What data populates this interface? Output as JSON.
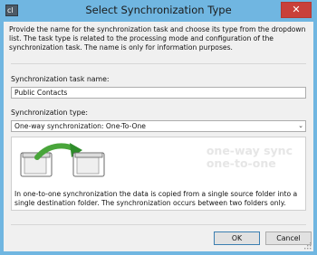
{
  "window": {
    "title": "Select Synchronization Type",
    "icon": "app-icon",
    "icon_text": "cl",
    "close_glyph": "✕",
    "accent": "#70b6e1"
  },
  "intro_text": "Provide the name for the synchronization task and choose its type from the dropdown list. The task type is related to the processing mode and configuration of the synchronization task. The name is only for information purposes.",
  "task_name": {
    "label": "Synchronization task name:",
    "value": "Public Contacts"
  },
  "sync_type": {
    "label": "Synchronization type:",
    "selected": "One-way synchronization: One-To-One"
  },
  "preview": {
    "line1": "one-way sync",
    "line2": "one-to-one",
    "icons": [
      "folder-icon",
      "arrow-icon",
      "folder-icon"
    ]
  },
  "description": "In one-to-one synchronization the data is copied from a single source folder into a single destination folder. The synchronization occurs between two folders only.",
  "buttons": {
    "ok": "OK",
    "cancel": "Cancel"
  }
}
